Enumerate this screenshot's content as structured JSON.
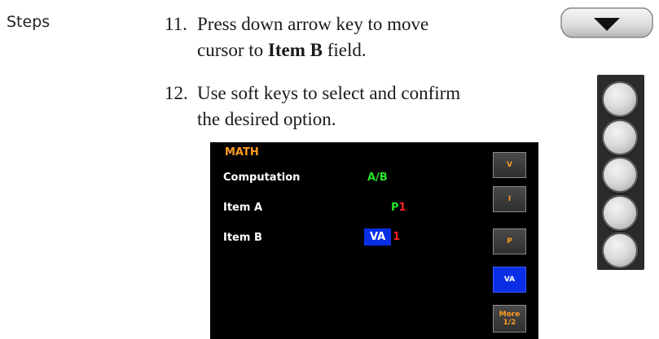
{
  "steps_label": "Steps",
  "step11": {
    "number": "11.",
    "line1": "Press down arrow key to move",
    "line2_pre": "cursor to ",
    "line2_bold": "Item B",
    "line2_post": " field."
  },
  "step12": {
    "number": "12.",
    "line1": "Use soft keys to select and confirm",
    "line2": "the desired option."
  },
  "arrow_key": {
    "icon": "down-arrow-icon"
  },
  "softkeys_panel": {
    "count": 5
  },
  "screen": {
    "title": "MATH",
    "computation_label": "Computation",
    "computation_value": "A/B",
    "item_a_label": "Item A",
    "item_a_value": "P",
    "item_a_index": "1",
    "item_b_label": "Item B",
    "item_b_value": "VA",
    "item_b_index": "1",
    "softkeys": [
      "V",
      "I",
      "P",
      "VA",
      "More",
      "1/2"
    ]
  },
  "colors": {
    "screen_bg": "#000000",
    "title": "#ff9a1f",
    "value_green": "#22e822",
    "index_red": "#ff2020",
    "highlight_blue": "#0a2ee6"
  }
}
